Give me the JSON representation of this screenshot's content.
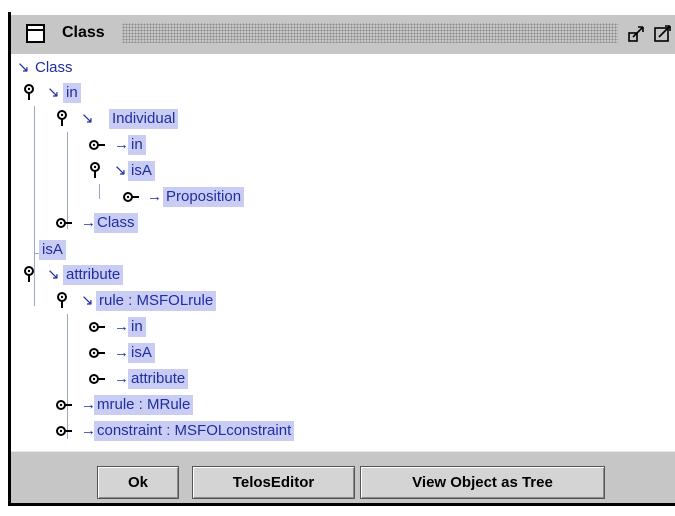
{
  "window": {
    "title": "Class"
  },
  "tree": {
    "root": "Class",
    "nodes": [
      {
        "label": "in",
        "arrow": "↘"
      },
      {
        "label": "Individual",
        "arrow": "↘"
      },
      {
        "label": "in",
        "arrow": "→"
      },
      {
        "label": "isA",
        "arrow": "↘"
      },
      {
        "label": "Proposition",
        "arrow": "→"
      },
      {
        "label": "Class",
        "arrow": "→"
      },
      {
        "label": "isA",
        "arrow": ""
      },
      {
        "label": "attribute",
        "arrow": "↘"
      },
      {
        "label": "rule : MSFOLrule",
        "arrow": "↘"
      },
      {
        "label": "in",
        "arrow": "→"
      },
      {
        "label": "isA",
        "arrow": "→"
      },
      {
        "label": "attribute",
        "arrow": "→"
      },
      {
        "label": "mrule : MRule",
        "arrow": "→"
      },
      {
        "label": "constraint : MSFOLconstraint",
        "arrow": "→"
      }
    ]
  },
  "buttons": {
    "ok": "Ok",
    "telos_editor": "TelosEditor",
    "view_tree": "View Object as Tree"
  }
}
